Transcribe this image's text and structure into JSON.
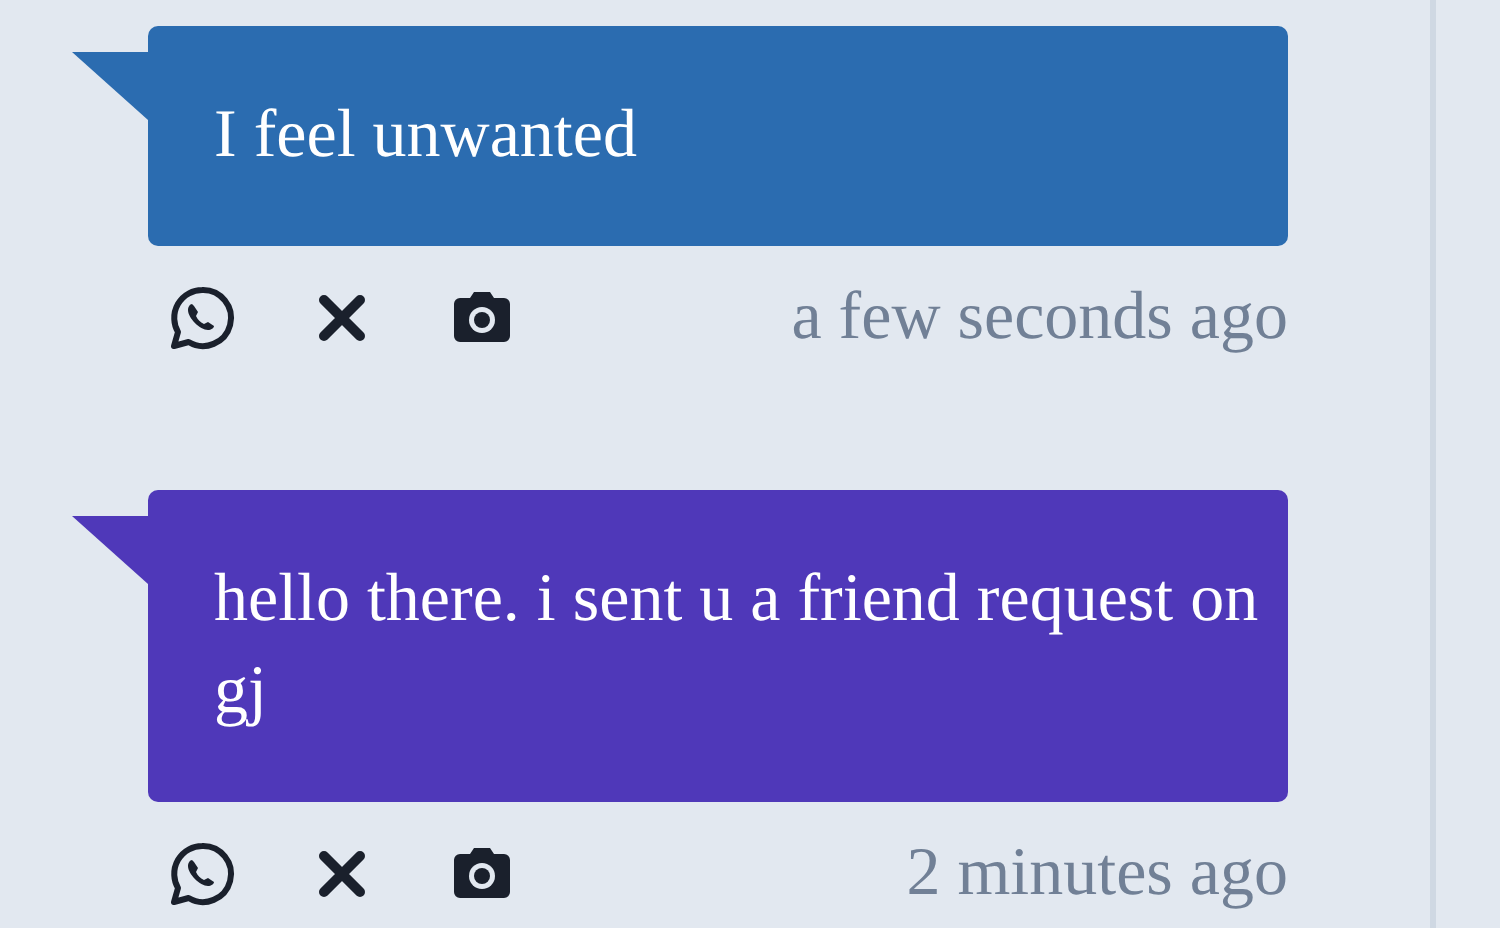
{
  "messages": [
    {
      "text": "I feel unwanted",
      "color": "#2b6cb0",
      "time": "a few seconds ago"
    },
    {
      "text": "hello there. i sent u a friend request on gj",
      "color": "#4f38b9",
      "time": "2 minutes ago"
    }
  ]
}
